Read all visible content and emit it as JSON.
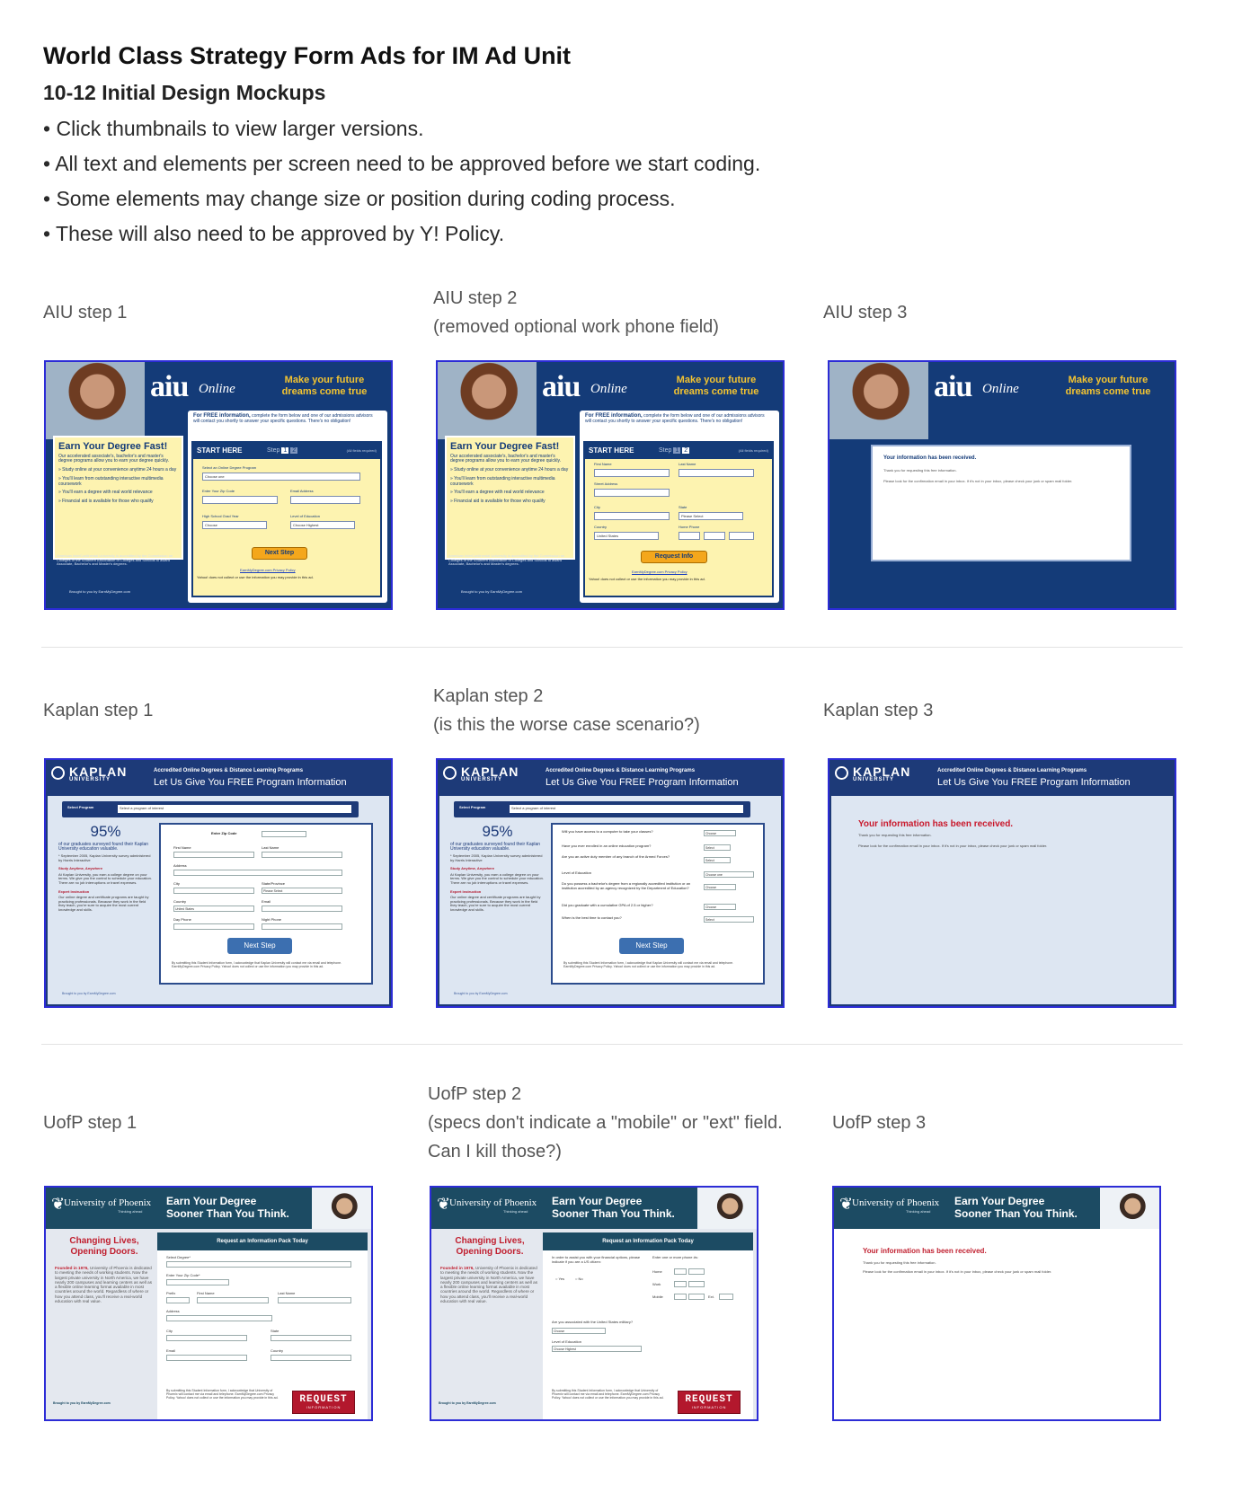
{
  "header": {
    "title": "World Class Strategy Form Ads for IM Ad Unit",
    "subtitle": "10-12 Initial Design Mockups",
    "bullets": [
      "Click thumbnails to view larger versions.",
      "All text and elements per screen need to be approved before we start coding.",
      "Some elements may change size or position during coding process.",
      "These will also need to be approved by Y! Policy."
    ]
  },
  "captions": {
    "aiu1": "AIU step 1",
    "aiu2_line1": "AIU step 2",
    "aiu2_line2": "(removed optional work phone field)",
    "aiu3": "AIU step 3",
    "kap1": "Kaplan step 1",
    "kap2_line1": "Kaplan step 2",
    "kap2_line2": "(is this the worse case scenario?)",
    "kap3": "Kaplan step 3",
    "uop1": "UofP step 1",
    "uop2_line1": "UofP step 2",
    "uop2_line2": "(specs don't indicate a \"mobile\" or \"ext\" field.",
    "uop2_line3": "Can I kill those?)",
    "uop3": "UofP step 3"
  },
  "aiu": {
    "logo": "aiu",
    "logo_sub": "Online",
    "tagline": "Make your future dreams come true",
    "earn_title": "Earn Your Degree Fast!",
    "earn_text": "Our accelerated associate's, bachelor's and master's degree programs allow you to earn your degree quickly.",
    "earn_points": [
      "Study online at your convenience anytime 24 hours a day",
      "You'll learn from outstanding interactive multimedia coursework",
      "You'll earn a degree with real world relevance",
      "Financial aid is available for those who qualify"
    ],
    "accreditation": "American InterContinental University is accredited by the Commission on Colleges of the Southern Association of Colleges and Schools to award Associate, Bachelor's and Master's degrees.",
    "brought_by": "Brought to you by EarnMyDegree.com",
    "intro_bold": "For FREE information,",
    "intro_text": "complete the form below and one of our admissions advisors will contact you shortly to answer your specific questions. There's no obligation!",
    "start_here": "START HERE",
    "step_label": "Step",
    "step_one": "1",
    "step_two": "2",
    "required_note": "(All fields required)",
    "s1": {
      "program_label": "Select an Online Degree Program",
      "program_value": "Choose one",
      "zip_label": "Enter Your Zip Code",
      "email_label": "Email Address",
      "grad_label": "High School Grad Year",
      "grad_value": "Choose",
      "edu_label": "Level of Education",
      "edu_value": "Choose Highest",
      "button": "Next Step"
    },
    "s2": {
      "first_label": "First Name",
      "last_label": "Last Name",
      "street_label": "Street Address",
      "city_label": "City",
      "state_label": "State",
      "state_value": "Please Select",
      "country_label": "Country",
      "country_value": "United States",
      "phone_label": "Home Phone",
      "button": "Request Info"
    },
    "privacy": "EarnMyDegree.com Privacy Policy",
    "yahoo_note": "Yahoo! does not collect or use the information you may provide in this ad.",
    "s3": {
      "title": "Your information has been received.",
      "thanks": "Thank you for requesting this free information.",
      "check": "Please look for the confirmation email in your inbox. If it's not in your inbox, please check your junk or spam mail folder."
    }
  },
  "kaplan": {
    "logo": "KAPLAN",
    "logo_sub": "UNIVERSITY",
    "head1": "Accredited Online Degrees & Distance Learning Programs",
    "head2": "Let Us Give You FREE Program Information",
    "select_label": "Select Program",
    "select_value": "Select a program of interest",
    "pct": "95%",
    "pct_text": "of our graduates surveyed found their Kaplan University education valuable.",
    "pct_note": "* September 2005, Kaplan University survey administered by Harris Interactive",
    "h_study": "Study Anytime, Anywhere",
    "t_study": "At Kaplan University, you earn a college degree on your terms. We give you the control to schedule your education. There are no job interruptions or travel expenses.",
    "h_expert": "Expert Instruction",
    "t_expert": "Our online degree and certificate programs are taught by practicing professionals. Because they work in the field they teach, you're sure to acquire the most current knowledge and skills.",
    "brought_by": "Brought to you by EarnMyDegree.com",
    "s1": {
      "zip_label": "Enter Zip Code",
      "first": "First Name",
      "last": "Last Name",
      "address": "Address",
      "city": "City",
      "state": "State/Province",
      "state_value": "Please Select",
      "country": "Country",
      "country_value": "United States",
      "email": "Email",
      "day": "Day Phone",
      "night": "Night Phone"
    },
    "s2": {
      "q1": "Will you have access to a computer to take your classes?",
      "q2": "Have you ever enrolled in an online education program?",
      "q3": "Are you an active duty member of any branch of the Armed Forces?",
      "q4": "Level of Education",
      "q5": "Do you possess a bachelor's degree from a regionally accredited institution or an institution accredited by an agency recognized by the Department of Education?",
      "q6": "Did you graduate with a cumulative GPA of 2.5 or higher?",
      "q7": "When is the best time to contact you?",
      "a_choose": "Choose",
      "a_select": "Select",
      "a_choose_one": "Choose one"
    },
    "button": "Next Step",
    "consent": "By submitting this Student Information form, I acknowledge that Kaplan University will contact me via email and telephone. EarnMyDegree.com Privacy Policy. Yahoo! does not collect or use the information you may provide in this ad.",
    "s3": {
      "title": "Your information has been received.",
      "thanks": "Thank you for requesting this free information.",
      "check": "Please look for the confirmation email in your inbox. If it's not in your inbox, please check your junk or spam mail folder."
    }
  },
  "uop": {
    "logo": "University of Phoenix",
    "logo_sub": "Thinking ahead",
    "tag1": "Earn Your Degree",
    "tag2": "Sooner Than You Think.",
    "left_h": "Changing Lives, Opening Doors.",
    "founded": "Founded in 1976,",
    "left_text": "University of Phoenix is dedicated to meeting the needs of working students. Now the largest private university in North America, we have nearly 200 campuses and learning centers as well as a flexible online learning format available in most countries around the world. Regardless of where or how you attend class, you'll receive a real-world education with real value.",
    "brought_by": "Brought to you by EarnMyDegree.com",
    "form_head": "Request an Information Pack Today",
    "s1": {
      "degree": "Select Degree*",
      "zip": "Enter Your Zip Code*",
      "prefix": "Prefix",
      "first": "First Name",
      "last": "Last Name",
      "address": "Address",
      "city": "City",
      "state": "State",
      "email": "Email",
      "country": "Country"
    },
    "s2": {
      "aid_q": "In order to assist you with your financial options, please indicate if you are a US citizen:",
      "yes": "Yes",
      "no": "No",
      "phone_q": "Enter one or more phone #s:",
      "home": "Home",
      "work": "Work",
      "mobile": "Mobile",
      "ext": "Ext.",
      "military_q": "Are you associated with the United States military?",
      "military_value": "Choose",
      "edu": "Level of Education",
      "edu_value": "Choose Highest"
    },
    "consent": "By submitting this Student Information form, I acknowledge that University of Phoenix will contact me via email and telephone. EarnMyDegree.com Privacy Policy. Yahoo! does not collect or use the information you may provide in this ad.",
    "request_a": "REQUEST",
    "request_b": "INFORMATION",
    "s3": {
      "title": "Your information has been received.",
      "thanks": "Thank you for requesting this free information.",
      "check": "Please look for the confirmation email in your inbox. If it's not in your inbox, please check your junk or spam mail folder."
    }
  }
}
